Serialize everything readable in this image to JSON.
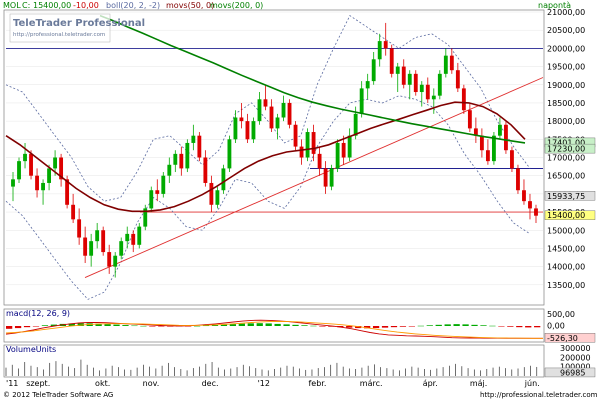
{
  "header": {
    "instrument": "MOL",
    "close_label": "C:",
    "close_value": "15400,00",
    "change": "-10,00",
    "boll": "boll(20, 2, -2)",
    "mov50": "movs(50, 0)",
    "mov200": "movs(200, 0)",
    "period": "napontà",
    "logo_title": "TeleTrader Professional",
    "logo_url": "http://professional.teletrader.com"
  },
  "footer": {
    "copyright": "© 2012 TeleTrader Software AG",
    "url": "http://professional.teletrader.com"
  },
  "colors": {
    "bull": "#00aa00",
    "bear": "#dd0000",
    "ma50": "#800000",
    "ma200": "#008000",
    "boll_band": "#5a6aa0",
    "trend": "#e03030",
    "hline": "#000080",
    "macd_line": "#cc0000",
    "macd_signal": "#ff9900"
  },
  "chart_data": [
    {
      "type": "candlestick",
      "title": "MOL",
      "ylim": [
        13000,
        21000
      ],
      "y_ticks": [
        "21000,00",
        "20500,00",
        "20000,00",
        "19500,00",
        "19000,00",
        "18500,00",
        "18000,00",
        "17500,00",
        "17000,00",
        "16500,00",
        "16000,00",
        "15500,00",
        "15000,00",
        "14500,00",
        "14000,00",
        "13500,00"
      ],
      "x_labels": [
        "'11",
        "szept.",
        "okt.",
        "nov.",
        "dec.",
        "'12",
        "febr.",
        "márc.",
        "ápr.",
        "máj.",
        "jún."
      ],
      "candles": [
        [
          16200,
          16600,
          15800,
          16400
        ],
        [
          16400,
          17000,
          16300,
          16900
        ],
        [
          16900,
          17400,
          16700,
          17100
        ],
        [
          17100,
          17200,
          16400,
          16500
        ],
        [
          16500,
          16700,
          15900,
          16100
        ],
        [
          16100,
          16400,
          15700,
          16300
        ],
        [
          16300,
          16800,
          16100,
          16700
        ],
        [
          16700,
          17200,
          16500,
          17000
        ],
        [
          17000,
          17100,
          16200,
          16400
        ],
        [
          16400,
          16500,
          15600,
          15700
        ],
        [
          15700,
          16000,
          15200,
          15300
        ],
        [
          15300,
          15600,
          14600,
          14800
        ],
        [
          14800,
          15100,
          14100,
          14300
        ],
        [
          14300,
          14900,
          14000,
          14700
        ],
        [
          14700,
          15200,
          14500,
          15000
        ],
        [
          15000,
          15100,
          14300,
          14400
        ],
        [
          14400,
          14600,
          13800,
          14000
        ],
        [
          14000,
          14400,
          13700,
          14300
        ],
        [
          14300,
          14800,
          14200,
          14700
        ],
        [
          14700,
          15100,
          14500,
          14900
        ],
        [
          14900,
          15000,
          14400,
          14600
        ],
        [
          14600,
          15200,
          14500,
          15100
        ],
        [
          15100,
          15700,
          15000,
          15600
        ],
        [
          15600,
          16200,
          15500,
          16100
        ],
        [
          16100,
          16400,
          15800,
          16000
        ],
        [
          16000,
          16600,
          15900,
          16500
        ],
        [
          16500,
          17000,
          16300,
          16800
        ],
        [
          16800,
          17200,
          16600,
          17100
        ],
        [
          17100,
          17300,
          16500,
          16700
        ],
        [
          16700,
          17500,
          16600,
          17400
        ],
        [
          17400,
          17900,
          17200,
          17600
        ],
        [
          17600,
          17700,
          16900,
          17000
        ],
        [
          17000,
          17200,
          16200,
          16300
        ],
        [
          16300,
          16500,
          15500,
          15700
        ],
        [
          15700,
          16200,
          15600,
          16100
        ],
        [
          16100,
          16800,
          16000,
          16700
        ],
        [
          16700,
          17600,
          16600,
          17500
        ],
        [
          17500,
          18300,
          17400,
          18100
        ],
        [
          18100,
          18500,
          17800,
          18000
        ],
        [
          18000,
          18200,
          17400,
          17500
        ],
        [
          17500,
          18100,
          17400,
          18000
        ],
        [
          18000,
          18800,
          17900,
          18600
        ],
        [
          18600,
          19000,
          18300,
          18400
        ],
        [
          18400,
          18600,
          17700,
          17800
        ],
        [
          17800,
          18200,
          17500,
          18100
        ],
        [
          18100,
          18700,
          18000,
          18500
        ],
        [
          18500,
          18600,
          17800,
          17900
        ],
        [
          17900,
          18000,
          17200,
          17300
        ],
        [
          17300,
          17500,
          16800,
          17000
        ],
        [
          17000,
          17800,
          16900,
          17700
        ],
        [
          17700,
          17900,
          16900,
          17100
        ],
        [
          17100,
          17300,
          16500,
          16700
        ],
        [
          16700,
          16900,
          16000,
          16200
        ],
        [
          16200,
          16800,
          16100,
          16700
        ],
        [
          16700,
          17500,
          16600,
          17400
        ],
        [
          17400,
          17600,
          16800,
          17000
        ],
        [
          17000,
          17800,
          16900,
          17600
        ],
        [
          17600,
          18400,
          17500,
          18200
        ],
        [
          18200,
          19100,
          18100,
          18900
        ],
        [
          18900,
          19300,
          18600,
          19100
        ],
        [
          19100,
          19900,
          19000,
          19700
        ],
        [
          19700,
          20400,
          19500,
          20200
        ],
        [
          20200,
          20700,
          19800,
          20000
        ],
        [
          20000,
          20100,
          19200,
          19300
        ],
        [
          19300,
          19600,
          18800,
          19500
        ],
        [
          19500,
          19700,
          18900,
          19000
        ],
        [
          19000,
          19400,
          18600,
          19300
        ],
        [
          19300,
          19400,
          18700,
          18800
        ],
        [
          18800,
          19100,
          18400,
          19000
        ],
        [
          19000,
          19200,
          18500,
          18600
        ],
        [
          18600,
          18900,
          18200,
          18700
        ],
        [
          18700,
          19400,
          18600,
          19300
        ],
        [
          19300,
          20000,
          19200,
          19800
        ],
        [
          19800,
          20000,
          19300,
          19400
        ],
        [
          19400,
          19600,
          18800,
          18900
        ],
        [
          18900,
          19000,
          18200,
          18300
        ],
        [
          18300,
          18500,
          17700,
          17800
        ],
        [
          17800,
          18100,
          17400,
          17600
        ],
        [
          17600,
          17800,
          17000,
          17200
        ],
        [
          17200,
          17500,
          16800,
          16900
        ],
        [
          16900,
          17700,
          16800,
          17600
        ],
        [
          17600,
          18100,
          17500,
          17900
        ],
        [
          17900,
          18000,
          17100,
          17200
        ],
        [
          17200,
          17300,
          16600,
          16700
        ],
        [
          16700,
          16800,
          16000,
          16100
        ],
        [
          16100,
          16400,
          15700,
          15800
        ],
        [
          15800,
          16000,
          15300,
          15600
        ],
        [
          15600,
          15700,
          15200,
          15400
        ]
      ],
      "ma50": [
        17600,
        17350,
        17050,
        16750,
        16450,
        16150,
        15900,
        15700,
        15580,
        15520,
        15520,
        15560,
        15650,
        15800,
        15980,
        16200,
        16450,
        16700,
        16900,
        17050,
        17150,
        17200,
        17250,
        17350,
        17500,
        17650,
        17800,
        17930,
        18050,
        18180,
        18300,
        18430,
        18520,
        18500,
        18400,
        18200,
        17900,
        17500
      ],
      "ma200": [
        20900,
        20750,
        20580,
        20420,
        20250,
        20080,
        19920,
        19760,
        19600,
        19430,
        19260,
        19100,
        18940,
        18780,
        18640,
        18520,
        18420,
        18330,
        18250,
        18170,
        18090,
        18010,
        17930,
        17860,
        17790,
        17720,
        17650,
        17580,
        17520,
        17460,
        17400
      ],
      "boll_upper": [
        19000,
        18800,
        18200,
        17600,
        17000,
        16200,
        15800,
        15900,
        16600,
        17500,
        17600,
        17200,
        16800,
        17200,
        18200,
        18500,
        18000,
        17400,
        17600,
        19000,
        20000,
        20900,
        20600,
        20300,
        20000,
        20300,
        20400,
        20100,
        19500,
        18900,
        18000,
        17300,
        16700
      ],
      "boll_lower": [
        15800,
        15400,
        14800,
        14200,
        13600,
        13100,
        13300,
        14100,
        15200,
        15900,
        15600,
        15100,
        15000,
        15600,
        16400,
        16300,
        15800,
        15600,
        16200,
        17300,
        18000,
        18500,
        18600,
        18500,
        18700,
        18600,
        18400,
        17900,
        17100,
        16500,
        15800,
        15200,
        14900
      ],
      "hlines": [
        20000,
        16700,
        15500
      ],
      "trend_from": [
        13700,
        0.17
      ],
      "trend_to": [
        19200,
        1.0
      ],
      "price_labels": [
        "17401,00",
        "17230,00",
        "15933,75",
        "15400,00"
      ]
    },
    {
      "type": "bar",
      "title": "macd(12, 26, 9)",
      "ylim": [
        -600,
        600
      ],
      "y_ticks": [
        "500,00",
        "0,00",
        "-526,30"
      ],
      "histogram": [
        -120,
        -90,
        -50,
        -10,
        30,
        60,
        90,
        110,
        120,
        115,
        100,
        80,
        60,
        40,
        20,
        5,
        -10,
        -20,
        -25,
        -20,
        -10,
        5,
        20,
        40,
        60,
        80,
        100,
        115,
        120,
        110,
        90,
        70,
        50,
        30,
        10,
        -10,
        -30,
        -50,
        -70,
        -90,
        -100,
        -90,
        -70,
        -50,
        -30,
        -10,
        10,
        30,
        50,
        70,
        80,
        70,
        50,
        30,
        10,
        -10,
        -30,
        -50,
        -60,
        -55
      ],
      "macd": [
        -350,
        -300,
        -240,
        -170,
        -90,
        -20,
        40,
        90,
        130,
        150,
        150,
        140,
        120,
        100,
        80,
        60,
        40,
        20,
        10,
        0,
        10,
        30,
        60,
        90,
        130,
        170,
        210,
        240,
        250,
        240,
        220,
        190,
        150,
        110,
        70,
        30,
        -10,
        -60,
        -120,
        -200,
        -280,
        -340,
        -380,
        -400,
        -420,
        -430,
        -440,
        -460,
        -480,
        -500,
        -510,
        -515,
        -520,
        -522,
        -524,
        -526,
        -526,
        -526,
        -526,
        -526
      ],
      "signal": [
        -300,
        -280,
        -250,
        -210,
        -160,
        -110,
        -60,
        -10,
        30,
        60,
        80,
        95,
        100,
        100,
        95,
        85,
        75,
        60,
        45,
        30,
        25,
        28,
        35,
        50,
        70,
        95,
        120,
        150,
        175,
        190,
        195,
        190,
        180,
        160,
        135,
        110,
        80,
        50,
        10,
        -40,
        -100,
        -160,
        -210,
        -260,
        -300,
        -340,
        -370,
        -400,
        -420,
        -440,
        -460,
        -475,
        -490,
        -500,
        -508,
        -515,
        -520,
        -523,
        -525,
        -526
      ]
    },
    {
      "type": "bar",
      "title": "VolumeUnits",
      "ylim": [
        0,
        300000
      ],
      "y_ticks": [
        "300000",
        "200000",
        "100000",
        "96985"
      ],
      "values": [
        90000,
        120000,
        80000,
        150000,
        110000,
        95000,
        70000,
        140000,
        160000,
        130000,
        100000,
        85000,
        175000,
        120000,
        90000,
        60000,
        80000,
        110000,
        95000,
        70000,
        65000,
        90000,
        120000,
        100000,
        80000,
        110000,
        140000,
        95000,
        75000,
        60000,
        85000,
        100000,
        130000,
        150000,
        90000,
        70000,
        80000,
        95000,
        120000,
        105000,
        85000,
        70000,
        60000,
        75000,
        90000,
        110000,
        100000,
        80000,
        65000,
        70000,
        85000,
        95000,
        120000,
        140000,
        100000,
        80000,
        75000,
        90000,
        110000,
        125000,
        95000,
        85000,
        70000,
        60000,
        80000,
        100000,
        90000,
        75000,
        65000,
        80000,
        95000,
        110000,
        130000,
        105000,
        85000,
        70000,
        60000,
        75000,
        90000,
        100000,
        85000,
        70000,
        80000,
        95000,
        110000,
        96985
      ]
    }
  ]
}
